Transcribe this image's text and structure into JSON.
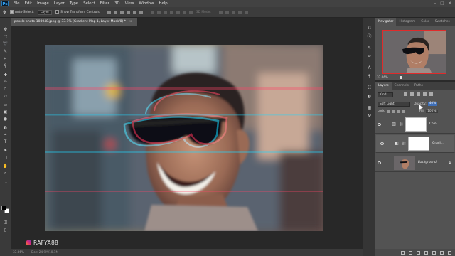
{
  "app": {
    "logo": "Ps"
  },
  "menu": [
    "File",
    "Edit",
    "Image",
    "Layer",
    "Type",
    "Select",
    "Filter",
    "3D",
    "View",
    "Window",
    "Help"
  ],
  "window_controls": [
    "–",
    "□",
    "✕"
  ],
  "options_bar": {
    "auto_select_label": "Auto-Select:",
    "auto_select_target": "Layer",
    "transform_label": "Show Transform Controls",
    "mode_label": "3D Mode:"
  },
  "document": {
    "tab_title": "pexels-photo-108048.jpeg @ 33.1% (Gradient Map 1, Layer Mask/8) *",
    "close": "×"
  },
  "status": {
    "zoom": "33.06%",
    "doc_size": "Doc: 24.9M/10.1M"
  },
  "watermark": "RAFYA88",
  "navigator": {
    "tabs": [
      "Navigator",
      "Histogram",
      "Color",
      "Swatches"
    ],
    "zoom": "33.06%"
  },
  "layers_panel": {
    "tabs": [
      "Layers",
      "Channels",
      "Paths"
    ],
    "kind_label": "Kind",
    "blend_mode": "Soft Light",
    "opacity_label": "Opacity:",
    "opacity_value": "40%",
    "lock_label": "Lock:",
    "fill_label": "Fill:",
    "fill_value": "100%",
    "layers": [
      {
        "name": "Colo...",
        "type": "adjustment"
      },
      {
        "name": "Gradi...",
        "type": "adjustment",
        "selected": true
      },
      {
        "name": "Background",
        "type": "image",
        "locked": true
      }
    ]
  },
  "icons": {
    "tools": [
      "move-icon",
      "marquee-icon",
      "lasso-icon",
      "quick-select-icon",
      "crop-icon",
      "eyedropper-icon",
      "healing-icon",
      "brush-icon",
      "stamp-icon",
      "history-brush-icon",
      "eraser-icon",
      "gradient-icon",
      "blur-icon",
      "dodge-icon",
      "pen-icon",
      "type-icon",
      "path-select-icon",
      "shape-icon",
      "hand-icon",
      "zoom-icon"
    ]
  },
  "colors": {
    "accent": "#3f6fb7",
    "selection_frame": "#e02b2b"
  }
}
